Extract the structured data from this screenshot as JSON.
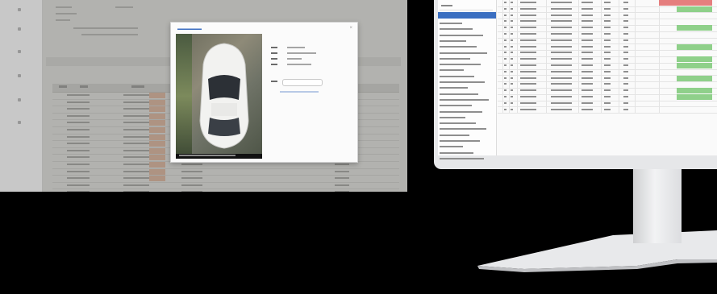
{
  "left_app": {
    "sidebar_icons": [
      "menu-icon",
      "home-icon",
      "camera-icon",
      "list-icon",
      "settings-icon"
    ],
    "table": {
      "row_count": 16
    }
  },
  "dialog": {
    "close_icon": "close-icon",
    "has_photo": true,
    "info_rows": 4
  },
  "right_app": {
    "selected_item_color": "#3b6fc1",
    "sidebar_items": 24,
    "grid_rows": 18,
    "status_colors": {
      "ok": "#8fd08a",
      "alert": "#e57e7e"
    }
  },
  "monitor": {
    "stand_color": "#e8e9eb"
  }
}
